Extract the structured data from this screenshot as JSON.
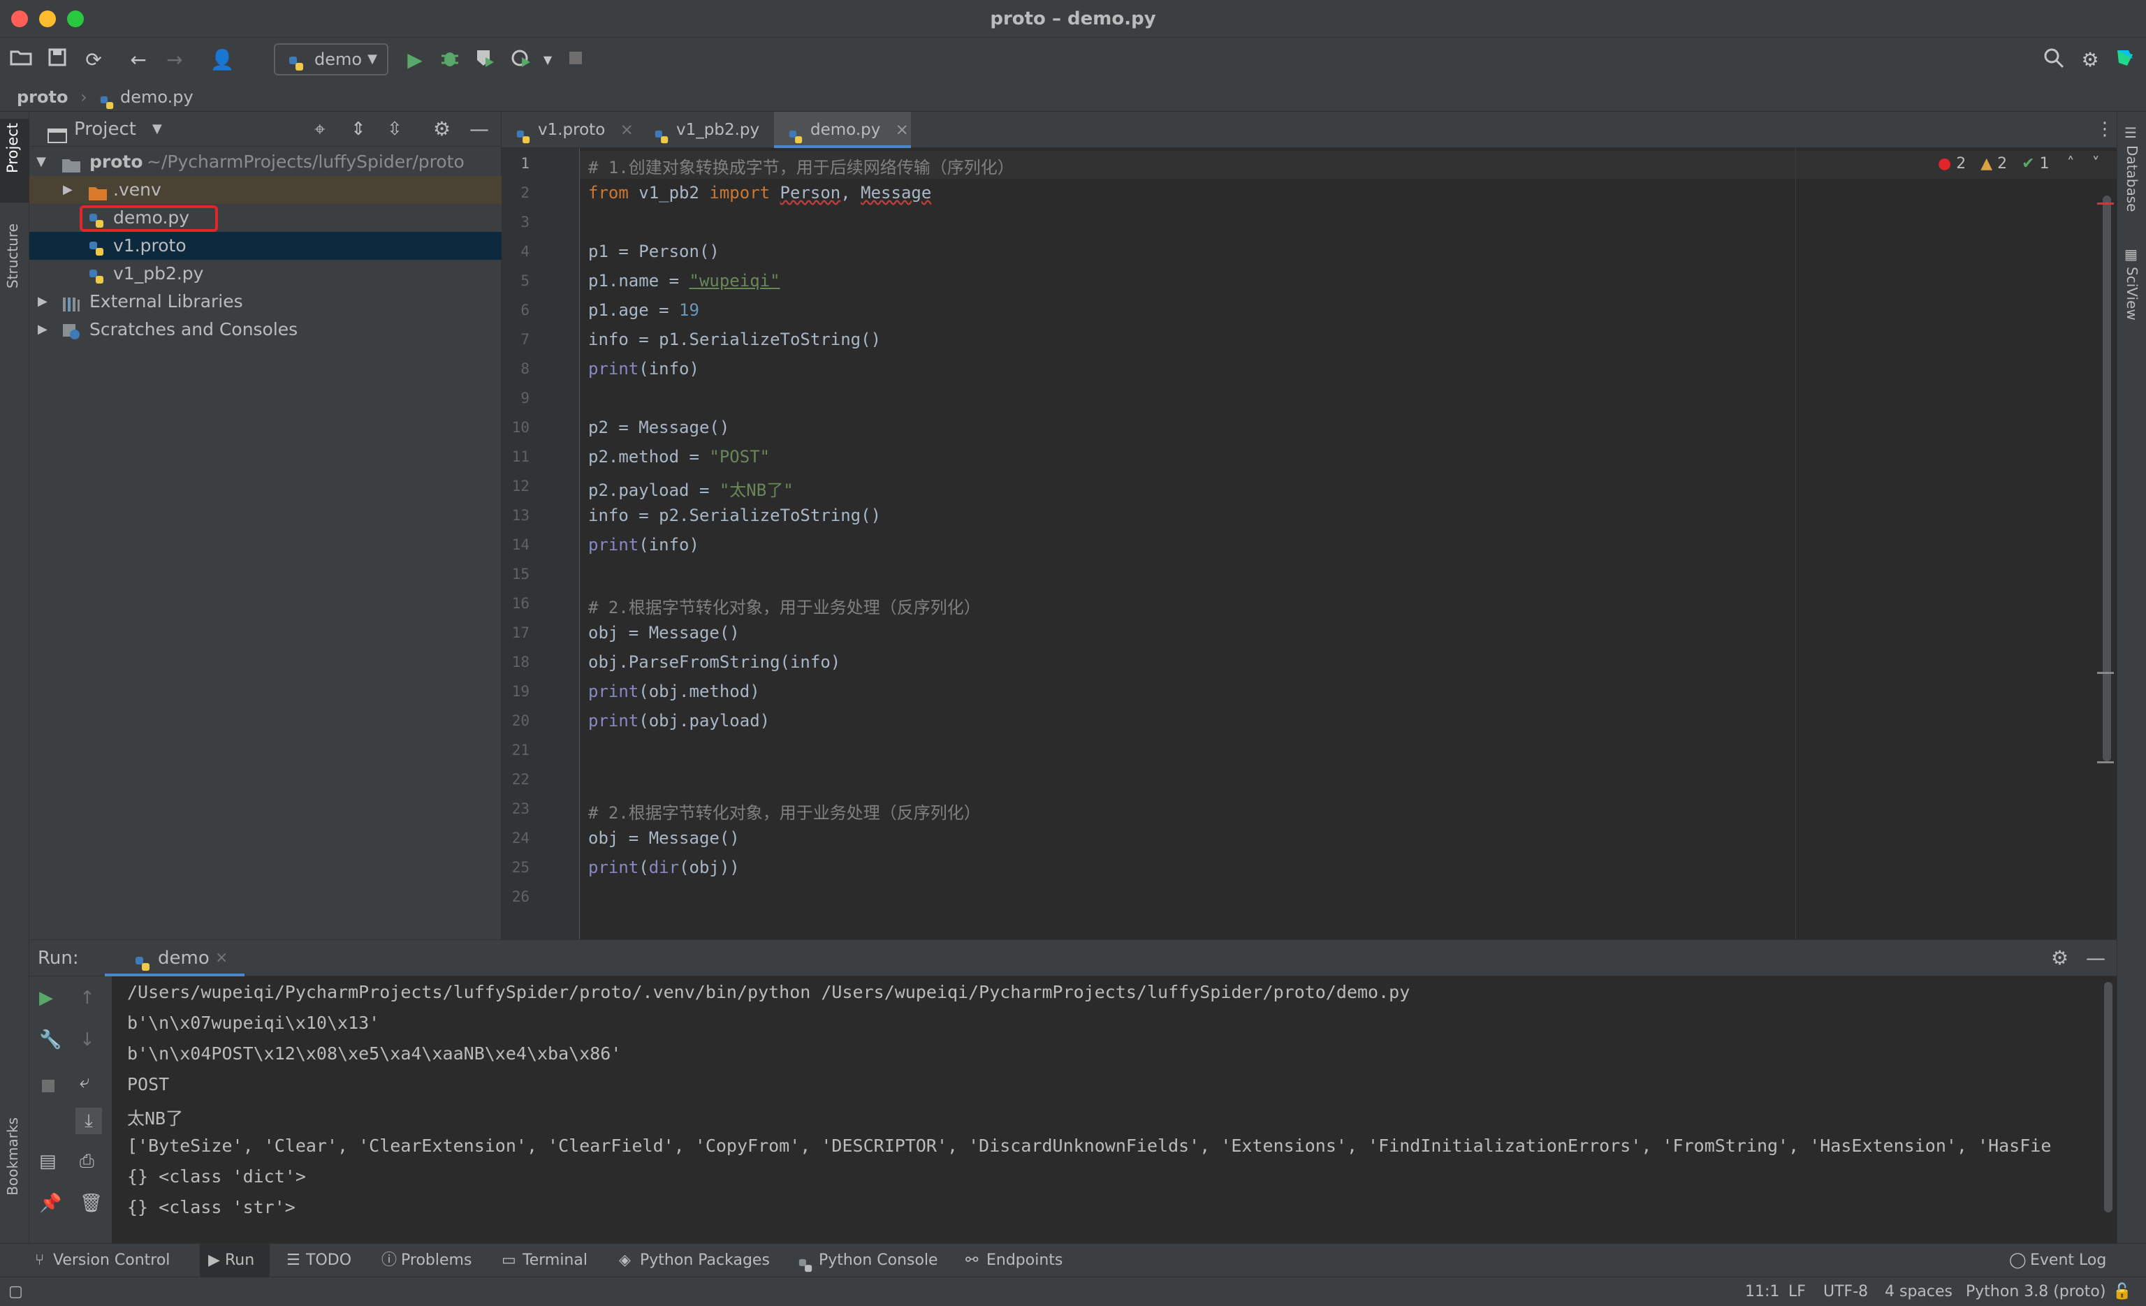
{
  "window": {
    "title": "proto – demo.py"
  },
  "toolbar": {
    "run_config": "demo"
  },
  "breadcrumb": {
    "root": "proto",
    "file": "demo.py"
  },
  "left_stripe": {
    "project_tab": "Project",
    "structure_tab": "Structure",
    "bookmarks_tab": "Bookmarks"
  },
  "right_stripe": {
    "database_tab": "Database",
    "sciview_tab": "SciView"
  },
  "project_panel": {
    "title": "Project",
    "tree": [
      {
        "label": "proto",
        "path": "~/PycharmProjects/luffySpider/proto"
      },
      {
        "label": ".venv"
      },
      {
        "label": "demo.py"
      },
      {
        "label": "v1.proto"
      },
      {
        "label": "v1_pb2.py"
      },
      {
        "label": "External Libraries"
      },
      {
        "label": "Scratches and Consoles"
      }
    ]
  },
  "editor": {
    "tabs": [
      {
        "label": "v1.proto"
      },
      {
        "label": "v1_pb2.py"
      },
      {
        "label": "demo.py"
      }
    ],
    "inspections": {
      "errors": "2",
      "warnings": "2",
      "ok": "1"
    },
    "line_numbers": [
      "1",
      "2",
      "3",
      "4",
      "5",
      "6",
      "7",
      "8",
      "9",
      "10",
      "11",
      "12",
      "13",
      "14",
      "15",
      "16",
      "17",
      "18",
      "19",
      "20",
      "21",
      "22",
      "23",
      "24",
      "25",
      "26"
    ],
    "code": {
      "l1": "# 1.创建对象转换成字节，用于后续网络传输（序列化）",
      "l2_kw1": "from",
      "l2_mod": " v1_pb2 ",
      "l2_kw2": "import",
      "l2_n1": "Person",
      "l2_sep": ", ",
      "l2_n2": "Message",
      "l4": "p1 = Person()",
      "l5_a": "p1.name = ",
      "l5_s": "\"wupeiqi\"",
      "l6_a": "p1.age = ",
      "l6_n": "19",
      "l7": "info = p1.SerializeToString()",
      "l8_f": "print",
      "l8_r": "(info)",
      "l10": "p2 = Message()",
      "l11_a": "p2.method = ",
      "l11_s": "\"POST\"",
      "l12_a": "p2.payload = ",
      "l12_s": "\"太NB了\"",
      "l13": "info = p2.SerializeToString()",
      "l14_f": "print",
      "l14_r": "(info)",
      "l16": "# 2.根据字节转化对象，用于业务处理（反序列化）",
      "l17": "obj = Message()",
      "l18": "obj.ParseFromString(info)",
      "l19_f": "print",
      "l19_r": "(obj.method)",
      "l20_f": "print",
      "l20_r": "(obj.payload)",
      "l23": "# 2.根据字节转化对象，用于业务处理（反序列化）",
      "l24": "obj = Message()",
      "l25_f": "print",
      "l25_m": "(",
      "l25_d": "dir",
      "l25_r": "(obj))"
    }
  },
  "run_panel": {
    "label": "Run:",
    "tab": "demo",
    "output": [
      "/Users/wupeiqi/PycharmProjects/luffySpider/proto/.venv/bin/python /Users/wupeiqi/PycharmProjects/luffySpider/proto/demo.py",
      "b'\\n\\x07wupeiqi\\x10\\x13'",
      "b'\\n\\x04POST\\x12\\x08\\xe5\\xa4\\xaaNB\\xe4\\xba\\x86'",
      "POST",
      "太NB了",
      "['ByteSize', 'Clear', 'ClearExtension', 'ClearField', 'CopyFrom', 'DESCRIPTOR', 'DiscardUnknownFields', 'Extensions', 'FindInitializationErrors', 'FromString', 'HasExtension', 'HasFie",
      "{} <class 'dict'>",
      "{} <class 'str'>"
    ]
  },
  "bottom_tools": {
    "version_control": "Version Control",
    "run": "Run",
    "todo": "TODO",
    "problems": "Problems",
    "terminal": "Terminal",
    "python_packages": "Python Packages",
    "python_console": "Python Console",
    "endpoints": "Endpoints",
    "event_log": "Event Log"
  },
  "status_bar": {
    "position": "11:1",
    "line_sep": "LF",
    "encoding": "UTF-8",
    "indent": "4 spaces",
    "interpreter": "Python 3.8 (proto)"
  },
  "colors": {
    "accent": "#4a88c7",
    "highlight_box": "#e0262b",
    "keyword": "#cc7832",
    "string": "#6a8759",
    "number": "#6897bb",
    "comment": "#808080"
  }
}
